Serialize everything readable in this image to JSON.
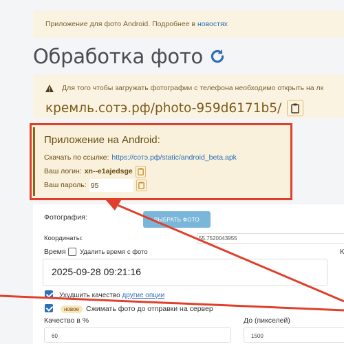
{
  "info_bar": {
    "text": "Приложение для фото Android. Подробнее в ",
    "link": "новостях"
  },
  "page": {
    "title": "Обработка фото"
  },
  "warning": {
    "text": "Для того чтобы загружать фотографии с телефона необходимо открыть на лк",
    "url": "кремль.сотэ.рф/photo-959d6171b5/"
  },
  "android": {
    "title": "Приложение на Android:",
    "download_label": "Скачать по ссылке:",
    "download_link": "https://сотэ.рф/static/android_beta.apk",
    "login_label": "Ваш логин:",
    "login_value": "xn--e1ajedsge",
    "password_label": "Ваш пароль:",
    "password_value": "95"
  },
  "form": {
    "photo_label": "Фотография:",
    "photo_button": "ВЫБРАТЬ ФОТО",
    "coords_label": "Координаты:",
    "coords_value": "55.7520043955",
    "time_label": "Время",
    "remove_time_label": "Удалить время с фото",
    "time_value": "2025-09-28 09:21:16",
    "right_cut_letter": "К",
    "improve_label": "Ухудшить качество",
    "other_options": "другие опции",
    "new_badge": "новое",
    "compress_label": "Сжимать фото до отправки на сервер",
    "quality_label": "Качество в %",
    "quality_value": "60",
    "size_label": "До (пикселей)",
    "size_value": "1500"
  },
  "colors": {
    "accent": "#2f6fb6",
    "highlight": "#e0402b",
    "warning_bg": "#fbf3e2"
  }
}
